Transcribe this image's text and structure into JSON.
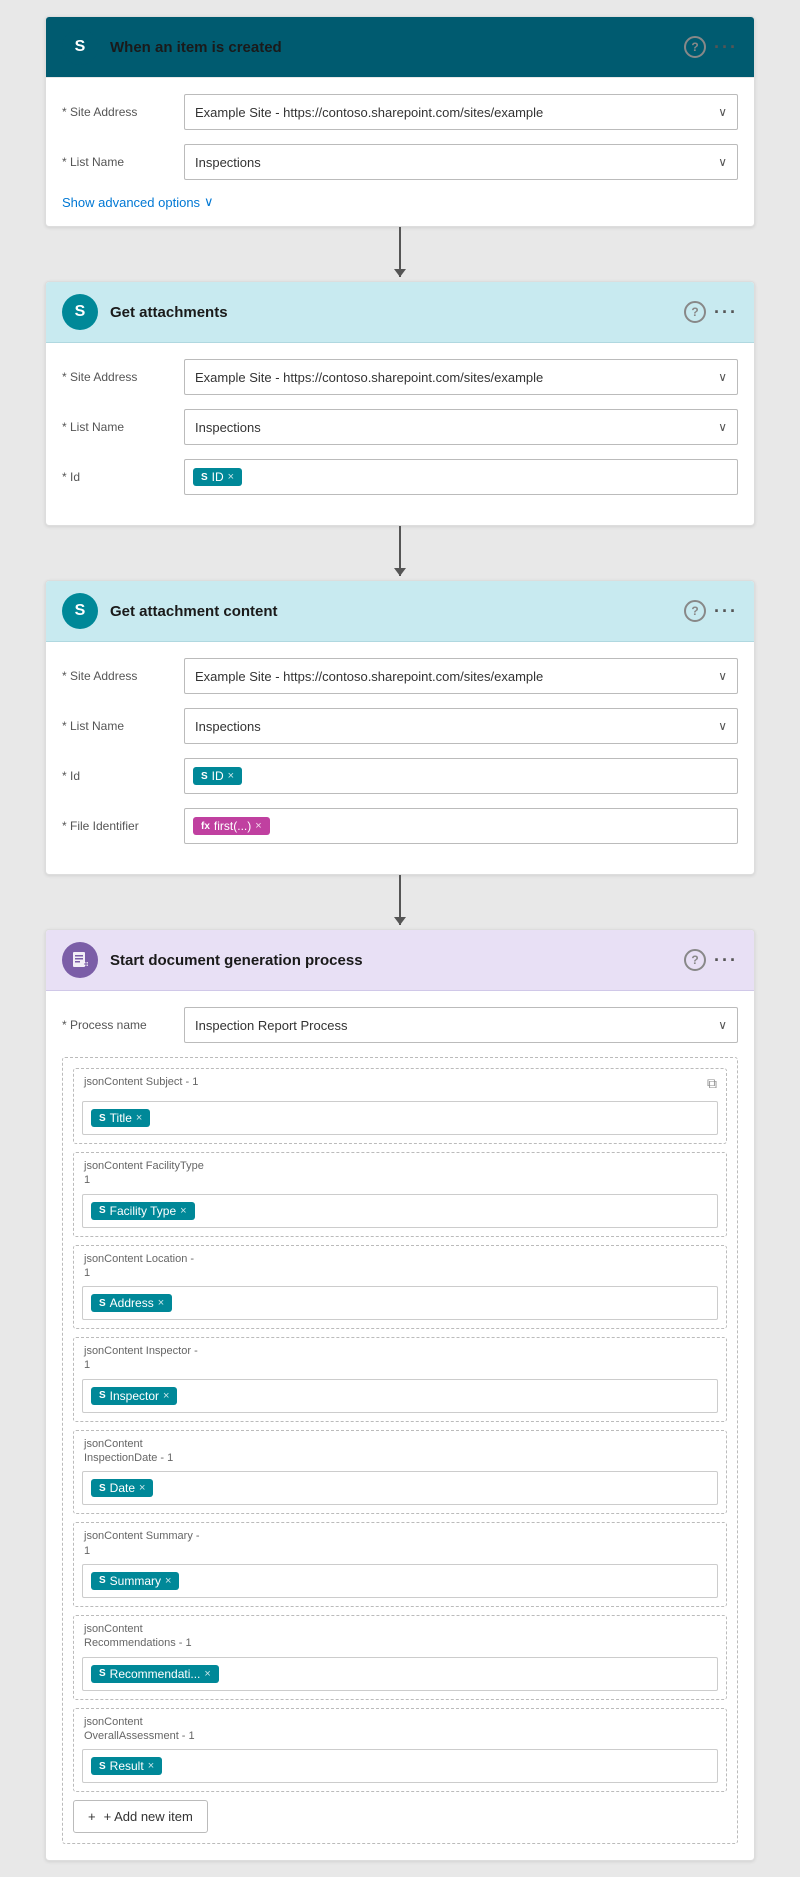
{
  "trigger": {
    "title": "When an item is created",
    "site_address_label": "* Site Address",
    "site_address_value": "Example Site - https://contoso.sharepoint.com/sites/example",
    "list_name_label": "* List Name",
    "list_name_value": "Inspections",
    "show_advanced": "Show advanced options"
  },
  "get_attachments": {
    "title": "Get attachments",
    "site_address_label": "* Site Address",
    "site_address_value": "Example Site - https://contoso.sharepoint.com/sites/example",
    "list_name_label": "* List Name",
    "list_name_value": "Inspections",
    "id_label": "* Id",
    "id_tag": "ID"
  },
  "get_attachment_content": {
    "title": "Get attachment content",
    "site_address_label": "* Site Address",
    "site_address_value": "Example Site - https://contoso.sharepoint.com/sites/example",
    "list_name_label": "* List Name",
    "list_name_value": "Inspections",
    "id_label": "* Id",
    "id_tag": "ID",
    "file_identifier_label": "* File Identifier",
    "file_identifier_tag": "first(...)"
  },
  "doc_gen": {
    "title": "Start document generation process",
    "process_name_label": "* Process name",
    "process_name_value": "Inspection Report Process",
    "sections": [
      {
        "label": "jsonContent Subject - 1",
        "tag": "Title",
        "type": "sp",
        "show_copy": true
      },
      {
        "label": "jsonContent FacilityType\n1",
        "tag": "Facility Type",
        "type": "sp",
        "show_copy": false
      },
      {
        "label": "jsonContent Location -\n1",
        "tag": "Address",
        "type": "sp",
        "show_copy": false
      },
      {
        "label": "jsonContent Inspector -\n1",
        "tag": "Inspector",
        "type": "sp",
        "show_copy": false
      },
      {
        "label": "jsonContent\nInspectionDate - 1",
        "tag": "Date",
        "type": "sp",
        "show_copy": false
      },
      {
        "label": "jsonContent Summary -\n1",
        "tag": "Summary",
        "type": "sp",
        "show_copy": false
      },
      {
        "label": "jsonContent\nRecommendations - 1",
        "tag": "Recommendati...",
        "type": "sp",
        "show_copy": false
      },
      {
        "label": "jsonContent\nOverallAssessment - 1",
        "tag": "Result",
        "type": "sp",
        "show_copy": false
      }
    ],
    "add_item_label": "+ Add new item"
  },
  "icons": {
    "sp_letter": "S",
    "fx_letter": "fx",
    "chevron_down": "∨",
    "more_dots": "···",
    "help": "?",
    "copy": "⧉",
    "plus": "+"
  }
}
